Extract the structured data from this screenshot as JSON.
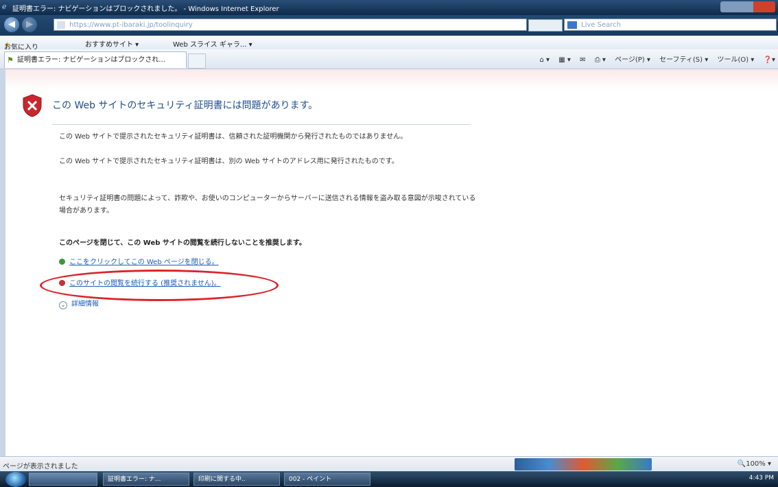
{
  "window": {
    "title": "証明書エラー: ナビゲーションはブロックされました。 - Windows Internet Explorer"
  },
  "address_bar": {
    "url": "https://www.pt-ibaraki.jp/toolinquiry",
    "search_placeholder": "Live Search"
  },
  "favorites_bar": {
    "favorites_label": "お気に入り",
    "suggested_sites": "おすすめサイト ▾",
    "web_slice": "Web スライス ギャラ... ▾"
  },
  "tab": {
    "title": "証明書エラー: ナビゲーションはブロックされ..."
  },
  "command_bar": {
    "page": "ページ(P) ▾",
    "safety": "セーフティ(S) ▾",
    "tools": "ツール(O) ▾",
    "help": "❓▾"
  },
  "content": {
    "heading": "この Web サイトのセキュリティ証明書には問題があります。",
    "para1_line1": "この Web サイトで提示されたセキュリティ証明書は、信頼された証明機関から発行されたものではありません。",
    "para2_line1": "この Web サイトで提示されたセキュリティ証明書は、別の Web サイトのアドレス用に発行されたものです。",
    "para3": "セキュリティ証明書の問題によって、詐欺や、お使いのコンピューターからサーバーに送信される情報を盗み取る意図が示唆されている場合があります。",
    "recommend": "このページを閉じて、この Web サイトの閲覧を続行しないことを推奨します。",
    "close_link": "ここをクリックしてこの Web ページを閉じる。",
    "continue_link": "このサイトの閲覧を続行する (推奨されません)。",
    "more_info": "詳細情報"
  },
  "status_bar": {
    "status": "ページが表示されました",
    "zoom": "🔍100% ▾"
  },
  "taskbar": {
    "buttons": [
      "証明書エラー: ナ...",
      "印刷に関する中..",
      "002 - ペイント"
    ],
    "clock": "4:43 PM"
  },
  "colors": {
    "heading": "#1f4e8c",
    "link": "#1b5cb5",
    "close_dot": "#3a9a3a",
    "continue_dot": "#c8323a",
    "highlight_oval": "#d8262a"
  }
}
